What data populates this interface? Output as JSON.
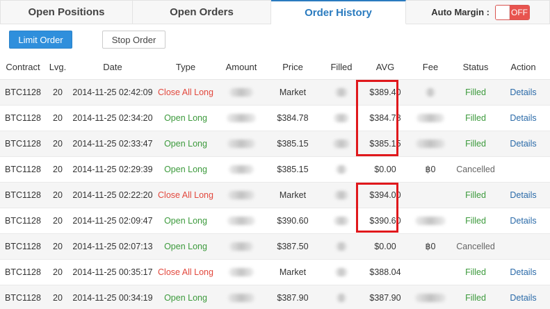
{
  "tabs": [
    {
      "label": "Open Positions"
    },
    {
      "label": "Open Orders"
    },
    {
      "label": "Order History"
    }
  ],
  "auto_margin": {
    "label": "Auto Margin :",
    "toggle_state": "OFF"
  },
  "order_buttons": {
    "limit": "Limit Order",
    "stop": "Stop Order"
  },
  "table": {
    "headers": [
      "Contract",
      "Lvg.",
      "Date",
      "Type",
      "Amount",
      "Price",
      "Filled",
      "AVG",
      "Fee",
      "Status",
      "Action"
    ],
    "rows": [
      {
        "contract": "BTC1128",
        "lvg": "20",
        "date": "2014-11-25 02:42:09",
        "type": "Close All Long",
        "price": "Market",
        "avg": "$389.40",
        "fee": "",
        "status": "Filled",
        "action": "Details"
      },
      {
        "contract": "BTC1128",
        "lvg": "20",
        "date": "2014-11-25 02:34:20",
        "type": "Open Long",
        "price": "$384.78",
        "avg": "$384.78",
        "fee": "",
        "status": "Filled",
        "action": "Details"
      },
      {
        "contract": "BTC1128",
        "lvg": "20",
        "date": "2014-11-25 02:33:47",
        "type": "Open Long",
        "price": "$385.15",
        "avg": "$385.15",
        "fee": "",
        "status": "Filled",
        "action": "Details"
      },
      {
        "contract": "BTC1128",
        "lvg": "20",
        "date": "2014-11-25 02:29:39",
        "type": "Open Long",
        "price": "$385.15",
        "avg": "$0.00",
        "fee": "฿0",
        "status": "Cancelled",
        "action": ""
      },
      {
        "contract": "BTC1128",
        "lvg": "20",
        "date": "2014-11-25 02:22:20",
        "type": "Close All Long",
        "price": "Market",
        "avg": "$394.00",
        "fee": "",
        "status": "Filled",
        "action": "Details"
      },
      {
        "contract": "BTC1128",
        "lvg": "20",
        "date": "2014-11-25 02:09:47",
        "type": "Open Long",
        "price": "$390.60",
        "avg": "$390.60",
        "fee": "",
        "status": "Filled",
        "action": "Details"
      },
      {
        "contract": "BTC1128",
        "lvg": "20",
        "date": "2014-11-25 02:07:13",
        "type": "Open Long",
        "price": "$387.50",
        "avg": "$0.00",
        "fee": "฿0",
        "status": "Cancelled",
        "action": ""
      },
      {
        "contract": "BTC1128",
        "lvg": "20",
        "date": "2014-11-25 00:35:17",
        "type": "Close All Long",
        "price": "Market",
        "avg": "$388.04",
        "fee": "",
        "status": "Filled",
        "action": "Details"
      },
      {
        "contract": "BTC1128",
        "lvg": "20",
        "date": "2014-11-25 00:34:19",
        "type": "Open Long",
        "price": "$387.90",
        "avg": "$387.90",
        "fee": "",
        "status": "Filled",
        "action": "Details"
      }
    ]
  },
  "colors": {
    "accent": "#2a7bbf",
    "limit_button": "#2f8fdc",
    "toggle_off": "#e8534e",
    "close_type": "#e2483d",
    "open_type": "#3c9a3c",
    "highlight": "#e0181c"
  }
}
